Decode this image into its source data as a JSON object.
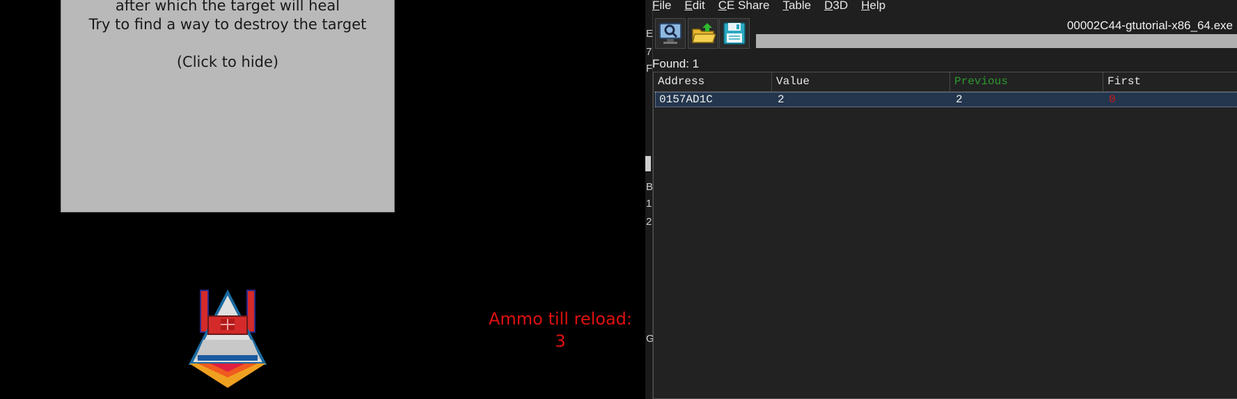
{
  "game": {
    "info_lines": [
      "after which the target will heal",
      "Try to find a way to destroy the target"
    ],
    "hide_text": "(Click to hide)",
    "ammo_label": "Ammo till reload:",
    "ammo_value": "3"
  },
  "cheat_engine": {
    "menu": [
      "File",
      "Edit",
      "CE Share",
      "Table",
      "D3D",
      "Help"
    ],
    "process_title": "00002C44-gtutorial-x86_64.exe",
    "found_label": "Found: 1",
    "left_strip_chars": [
      "E",
      "7",
      "F",
      "B",
      "1",
      "2",
      "G"
    ],
    "columns": [
      "Address",
      "Value",
      "Previous",
      "First"
    ],
    "rows": [
      {
        "address": "0157AD1C",
        "value": "2",
        "previous": "2",
        "first": "0"
      }
    ],
    "toolbar": {
      "scan_icon": "computer-search-icon",
      "open_icon": "open-folder-icon",
      "save_icon": "floppy-save-icon"
    }
  }
}
